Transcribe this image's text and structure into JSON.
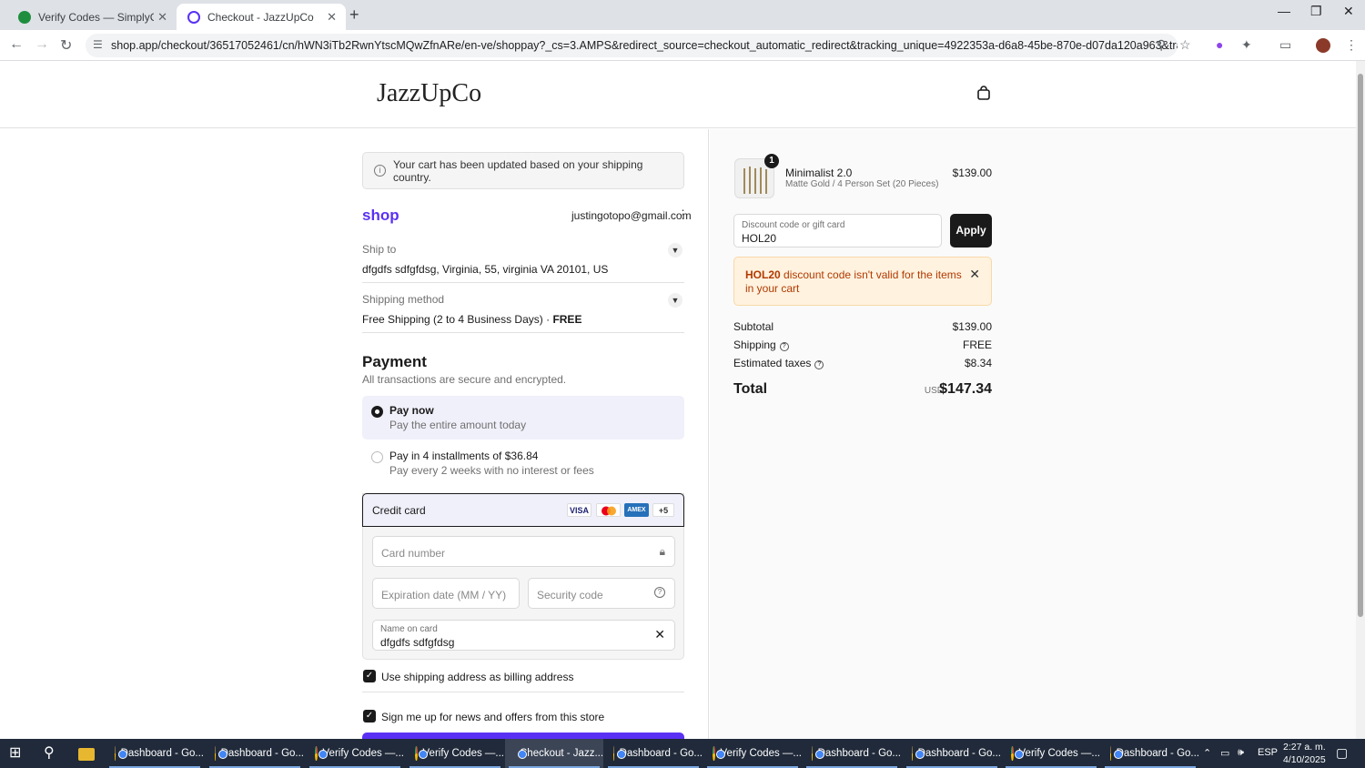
{
  "browser": {
    "tabs": [
      {
        "title": "Verify Codes — SimplyCodes",
        "active": false
      },
      {
        "title": "Checkout - JazzUpCo",
        "active": true
      }
    ],
    "url": "shop.app/checkout/36517052461/cn/hWN3iTb2RwnYtscMQwZfnARe/en-ve/shoppay?_cs=3.AMPS&redirect_source=checkout_automatic_redirect&tracking_unique=4922353a-d6a8-45be-870e-d07da120a963&tracking_visit=15b145b6..."
  },
  "store": {
    "name": "JazzUpCo"
  },
  "checkout": {
    "notice": "Your cart has been updated based on your shipping country.",
    "shop_logo": "shop",
    "email": "justingotopo@gmail.com",
    "ship_to": {
      "label": "Ship to",
      "value": "dfgdfs sdfgfdsg, Virginia, 55, virginia VA 20101, US"
    },
    "shipping_method": {
      "label": "Shipping method",
      "value": "Free Shipping (2 to 4 Business Days) · ",
      "price": "FREE"
    },
    "payment": {
      "heading": "Payment",
      "subheading": "All transactions are secure and encrypted.",
      "options": [
        {
          "title": "Pay now",
          "subtitle": "Pay the entire amount today",
          "selected": true
        },
        {
          "title": "Pay in 4 installments of $36.84",
          "subtitle": "Pay every 2 weeks with no interest or fees",
          "selected": false
        }
      ],
      "credit_card": {
        "label": "Credit card",
        "brands": [
          "VISA",
          "",
          "AMEX",
          "+5"
        ],
        "card_number_placeholder": "Card number",
        "expiration_placeholder": "Expiration date (MM / YY)",
        "security_placeholder": "Security code",
        "name_label": "Name on card",
        "name_value": "dfgdfs sdfgfdsg"
      }
    },
    "use_shipping_billing": "Use shipping address as billing address",
    "newsletter": "Sign me up for news and offers from this store"
  },
  "summary": {
    "product": {
      "qty": "1",
      "name": "Minimalist 2.0",
      "variant": "Matte Gold / 4 Person Set (20 Pieces)",
      "price": "$139.00"
    },
    "discount_label": "Discount code or gift card",
    "discount_value": "HOL20",
    "apply_label": "Apply",
    "error_code": "HOL20",
    "error_text": " discount code isn't valid for the items in your cart",
    "subtotal_label": "Subtotal",
    "subtotal": "$139.00",
    "shipping_label": "Shipping",
    "shipping": "FREE",
    "taxes_label": "Estimated taxes",
    "taxes": "$8.34",
    "total_label": "Total",
    "currency": "USD",
    "total": "$147.34"
  },
  "taskbar": {
    "items": [
      "Dashboard - Go...",
      "Dashboard - Go...",
      "Verify Codes —...",
      "Verify Codes —...",
      "Checkout - Jazz...",
      "Dashboard - Go...",
      "Verify Codes —...",
      "Dashboard - Go...",
      "Dashboard - Go...",
      "Verify Codes —...",
      "Dashboard - Go..."
    ],
    "lang": "ESP",
    "time": "2:27 a. m.",
    "date": "4/10/2025"
  },
  "colors": {
    "shop_purple": "#5a31f4",
    "error_bg": "#fff2df",
    "error_text": "#b13a00"
  }
}
